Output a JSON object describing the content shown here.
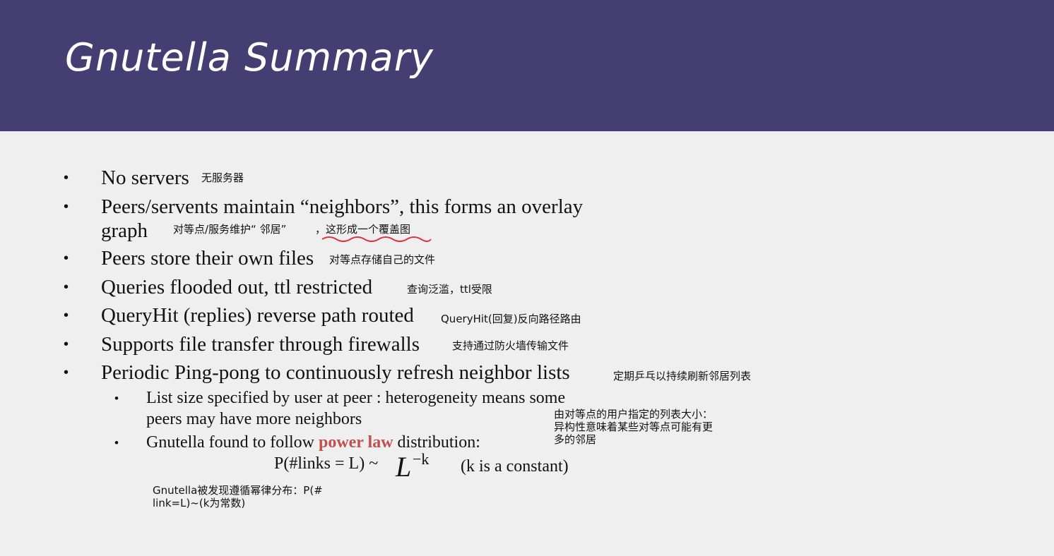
{
  "title": "Gnutella Summary",
  "bullet_glyph": "•",
  "items": [
    {
      "en": "No servers",
      "cn": "无服务器"
    },
    {
      "en1": "Peers/servents maintain “neighbors”, this forms an overlay",
      "en2": "graph",
      "cn_a": "对等点/服务维护“ 邻居”",
      "cn_b": "，这形成一个覆盖图"
    },
    {
      "en": "Peers store their own files",
      "cn": "对等点存储自己的文件"
    },
    {
      "en": "Queries flooded out, ttl restricted",
      "cn": "查询泛滥，ttl受限"
    },
    {
      "en": "QueryHit (replies) reverse path routed",
      "cn": "QueryHit(回复)反向路径路由"
    },
    {
      "en": "Supports file transfer through firewalls",
      "cn": "支持通过防火墙传输文件"
    },
    {
      "en": "Periodic Ping-pong to continuously refresh neighbor lists",
      "cn": "定期乒乓以持续刷新邻居列表"
    }
  ],
  "subitems": [
    {
      "line1": "List size specified by user at peer : heterogeneity means some",
      "line2": "peers may have more neighbors"
    },
    {
      "pre": "Gnutella found to follow ",
      "highlight": "power law",
      "post": " distribution:"
    }
  ],
  "sub_note_cn": [
    "由对等点的用户指定的列表大小：",
    "异构性意味着某些对等点可能有更",
    "多的邻居"
  ],
  "formula": {
    "left": "P(#links = L) ~",
    "base": "L",
    "exponent": "−k",
    "note": "(k is a constant)"
  },
  "formula_note_cn": [
    "Gnutella被发现遵循幂律分布：P(#",
    "link=L)~(k为常数)"
  ],
  "colors": {
    "header_bg": "#443e72",
    "body_bg": "#efefef",
    "highlight": "#c0504d",
    "underline": "#d9363e"
  }
}
